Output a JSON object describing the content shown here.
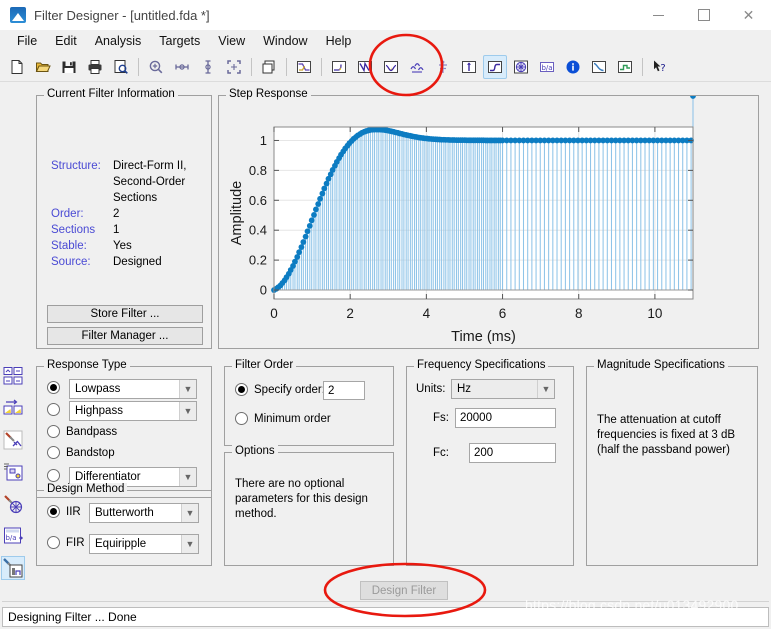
{
  "window": {
    "title": "Filter Designer -  [untitled.fda *]",
    "icon": "matlab-filter-icon",
    "buttons": {
      "minimize": "—",
      "maximize": "□",
      "close": "✕"
    }
  },
  "menubar": {
    "items": [
      "File",
      "Edit",
      "Analysis",
      "Targets",
      "View",
      "Window",
      "Help"
    ]
  },
  "toolbar": {
    "items": [
      {
        "name": "new-filter-icon",
        "tip": "New"
      },
      {
        "name": "open-icon",
        "tip": "Open"
      },
      {
        "name": "save-icon",
        "tip": "Save"
      },
      {
        "name": "print-icon",
        "tip": "Print"
      },
      {
        "name": "print-preview-icon",
        "tip": "Print Preview"
      },
      {
        "sep": true
      },
      {
        "name": "zoom-in-icon",
        "tip": "Zoom In"
      },
      {
        "name": "zoom-x-icon",
        "tip": "Zoom X"
      },
      {
        "name": "zoom-y-icon",
        "tip": "Zoom Y"
      },
      {
        "name": "full-view-icon",
        "tip": "Restore Default View"
      },
      {
        "sep": true
      },
      {
        "name": "new-window-icon",
        "tip": "New Analysis Window"
      },
      {
        "sep": true
      },
      {
        "name": "filter-specifications-icon",
        "tip": "Filter Specifications"
      },
      {
        "sep": true
      },
      {
        "name": "magnitude-response-icon",
        "tip": "Magnitude Response"
      },
      {
        "name": "phase-response-icon",
        "tip": "Phase Response"
      },
      {
        "name": "magnitude-and-phase-icon",
        "tip": "Magnitude and Phase Response"
      },
      {
        "name": "group-delay-icon",
        "tip": "Group Delay Response"
      },
      {
        "name": "phase-delay-icon",
        "tip": "Phase Delay"
      },
      {
        "name": "impulse-response-icon",
        "tip": "Impulse Response"
      },
      {
        "name": "step-response-icon",
        "tip": "Step Response",
        "active": true
      },
      {
        "name": "pole-zero-plot-icon",
        "tip": "Pole/Zero Plot"
      },
      {
        "name": "filter-coefficients-icon",
        "tip": "Filter Coefficients"
      },
      {
        "name": "filter-information-icon",
        "tip": "Filter Information"
      },
      {
        "name": "magnitude-response-estimate-icon",
        "tip": "Magnitude Response Estimate"
      },
      {
        "name": "round-off-noise-power-icon",
        "tip": "Round-off Noise Power Spectrum"
      },
      {
        "sep": true
      },
      {
        "name": "help-pointer-icon",
        "tip": "What's This?"
      }
    ]
  },
  "sidebar": {
    "items": [
      {
        "name": "design-filter-side-icon",
        "tip": "Design Filter"
      },
      {
        "name": "import-filter-side-icon",
        "tip": "Import Filter"
      },
      {
        "name": "quantize-filter-side-icon",
        "tip": "Set Quantization Parameters"
      },
      {
        "name": "realize-model-side-icon",
        "tip": "Realize Model"
      },
      {
        "name": "transform-filter-side-icon",
        "tip": "Transform Filter"
      },
      {
        "name": "multirate-filter-side-icon",
        "tip": "Create a Multirate Filter"
      },
      {
        "name": "pole-zero-editor-side-icon",
        "tip": "Pole/Zero Editor",
        "active": true
      }
    ]
  },
  "current_filter_information": {
    "title": "Current Filter Information",
    "fields": [
      {
        "key": "Structure:",
        "value": "Direct-Form II,",
        "value2": "Second-Order Sections"
      },
      {
        "key": "Order:",
        "value": "2"
      },
      {
        "key": "Sections",
        "value": "1"
      },
      {
        "key": "Stable:",
        "value": "Yes"
      },
      {
        "key": "Source:",
        "value": "Designed"
      }
    ],
    "store_filter_label": "Store Filter ...",
    "filter_manager_label": "Filter Manager ..."
  },
  "step_response": {
    "title": "Step Response"
  },
  "chart_data": {
    "type": "line",
    "title": "Step Response",
    "xlabel": "Time (ms)",
    "ylabel": "Amplitude",
    "xlim": [
      0,
      11
    ],
    "ylim": [
      -0.06,
      1.09
    ],
    "xticks": [
      0,
      2,
      4,
      6,
      8,
      10
    ],
    "yticks": [
      0,
      0.2,
      0.4,
      0.6,
      0.8,
      1
    ],
    "grid": true,
    "legend": "none",
    "style": "stem",
    "series": [
      {
        "name": "Step response",
        "color": "#0c7cc2",
        "x": [
          0.0,
          0.06,
          0.11,
          0.17,
          0.22,
          0.28,
          0.33,
          0.39,
          0.44,
          0.5,
          0.55,
          0.61,
          0.66,
          0.72,
          0.77,
          0.83,
          0.88,
          0.94,
          0.99,
          1.05,
          1.1,
          1.16,
          1.21,
          1.27,
          1.32,
          1.38,
          1.43,
          1.49,
          1.54,
          1.6,
          1.65,
          1.71,
          1.76,
          1.82,
          1.87,
          1.93,
          1.98,
          2.04,
          2.09,
          2.15,
          2.2,
          2.26,
          2.31,
          2.37,
          2.42,
          2.48,
          2.53,
          2.59,
          2.64,
          2.7,
          2.75,
          2.81,
          2.86,
          2.92,
          2.97,
          3.03,
          3.08,
          3.14,
          3.19,
          3.25,
          3.3,
          3.36,
          3.41,
          3.47,
          3.52,
          3.58,
          3.63,
          3.69,
          3.74,
          3.8,
          3.85,
          3.91,
          3.96,
          4.02,
          4.07,
          4.13,
          4.18,
          4.24,
          4.29,
          4.35,
          4.4,
          4.46,
          4.51,
          4.57,
          4.62,
          4.68,
          4.73,
          4.79,
          4.84,
          4.9,
          4.95,
          5.01,
          5.06,
          5.12,
          5.17,
          5.23,
          5.28,
          5.34,
          5.39,
          5.45,
          5.5,
          5.56,
          5.61,
          5.67,
          5.72,
          5.78,
          5.83,
          5.89,
          5.94,
          6.0,
          6.11,
          6.22,
          6.33,
          6.44,
          6.55,
          6.66,
          6.77,
          6.88,
          6.99,
          7.1,
          7.21,
          7.32,
          7.43,
          7.54,
          7.65,
          7.76,
          7.87,
          7.98,
          8.09,
          8.2,
          8.31,
          8.42,
          8.53,
          8.64,
          8.75,
          8.86,
          8.97,
          9.08,
          9.19,
          9.3,
          9.41,
          9.52,
          9.63,
          9.74,
          9.85,
          9.96,
          10.07,
          10.18,
          10.29,
          10.4,
          10.51,
          10.62,
          10.73,
          10.84,
          10.95,
          11.0
        ],
        "y": [
          0.0,
          0.008,
          0.018,
          0.031,
          0.047,
          0.065,
          0.086,
          0.109,
          0.134,
          0.161,
          0.19,
          0.221,
          0.253,
          0.287,
          0.321,
          0.357,
          0.393,
          0.429,
          0.466,
          0.502,
          0.539,
          0.575,
          0.61,
          0.645,
          0.679,
          0.712,
          0.744,
          0.774,
          0.803,
          0.831,
          0.857,
          0.882,
          0.905,
          0.927,
          0.947,
          0.965,
          0.982,
          0.997,
          1.011,
          1.023,
          1.034,
          1.043,
          1.051,
          1.058,
          1.063,
          1.067,
          1.07,
          1.072,
          1.073,
          1.073,
          1.073,
          1.072,
          1.071,
          1.069,
          1.067,
          1.064,
          1.061,
          1.058,
          1.054,
          1.051,
          1.047,
          1.044,
          1.04,
          1.037,
          1.034,
          1.031,
          1.028,
          1.025,
          1.023,
          1.02,
          1.018,
          1.016,
          1.014,
          1.013,
          1.011,
          1.01,
          1.009,
          1.008,
          1.007,
          1.006,
          1.005,
          1.005,
          1.004,
          1.004,
          1.003,
          1.003,
          1.003,
          1.002,
          1.002,
          1.002,
          1.002,
          1.002,
          1.001,
          1.001,
          1.001,
          1.001,
          1.001,
          1.001,
          1.001,
          1.001,
          1.001,
          1.0,
          1.0,
          1.0,
          1.0,
          1.0,
          1.0,
          1.0,
          1.0,
          1.0,
          1.0,
          1.0,
          1.0,
          1.0,
          1.0,
          1.0,
          1.0,
          1.0,
          1.0,
          1.0,
          1.0,
          1.0,
          1.0,
          1.0,
          1.0,
          1.0,
          1.0,
          1.0,
          1.0,
          1.0,
          1.0,
          1.0,
          1.0,
          1.0,
          1.0,
          1.0,
          1.0,
          1.0,
          1.0,
          1.0,
          1.0,
          1.0,
          1.0,
          1.0,
          1.0,
          1.0,
          1.0,
          1.0,
          1.0,
          1.0,
          1.0,
          1.0,
          1.0,
          1.0,
          1.0
        ]
      }
    ]
  },
  "response_type": {
    "title": "Response Type",
    "options": [
      {
        "label": "Lowpass",
        "selected": true,
        "combo": true
      },
      {
        "label": "Highpass",
        "selected": false,
        "combo": true
      },
      {
        "label": "Bandpass",
        "selected": false,
        "combo": false
      },
      {
        "label": "Bandstop",
        "selected": false,
        "combo": false
      },
      {
        "label": "Differentiator",
        "selected": false,
        "combo": true
      }
    ]
  },
  "design_method": {
    "title": "Design Method",
    "options": [
      {
        "label": "IIR",
        "value": "Butterworth",
        "selected": true
      },
      {
        "label": "FIR",
        "value": "Equiripple",
        "selected": false
      }
    ]
  },
  "filter_order": {
    "title": "Filter Order",
    "specify_label": "Specify order:",
    "specify_value": "2",
    "specify_selected": true,
    "minimum_label": "Minimum order",
    "minimum_selected": false
  },
  "options_panel": {
    "title": "Options",
    "text": "There are no optional parameters for this design method."
  },
  "frequency_specifications": {
    "title": "Frequency Specifications",
    "units_label": "Units:",
    "units_value": "Hz",
    "fs_label": "Fs:",
    "fs_value": "20000",
    "fc_label": "Fc:",
    "fc_value": "200"
  },
  "magnitude_specifications": {
    "title": "Magnitude Specifications",
    "text": "The attenuation at cutoff frequencies is fixed at 3 dB (half the passband power)"
  },
  "design_filter_button": {
    "label": "Design Filter",
    "enabled": false
  },
  "statusbar": {
    "text": "Designing Filter ... Done"
  },
  "watermark": {
    "text": "https://blog.csdn.net/u013492900"
  },
  "annotations": {
    "circle_toolbar": "red-ellipse-highlight",
    "circle_design_filter": "red-ellipse-highlight",
    "color": "#e8190f"
  }
}
